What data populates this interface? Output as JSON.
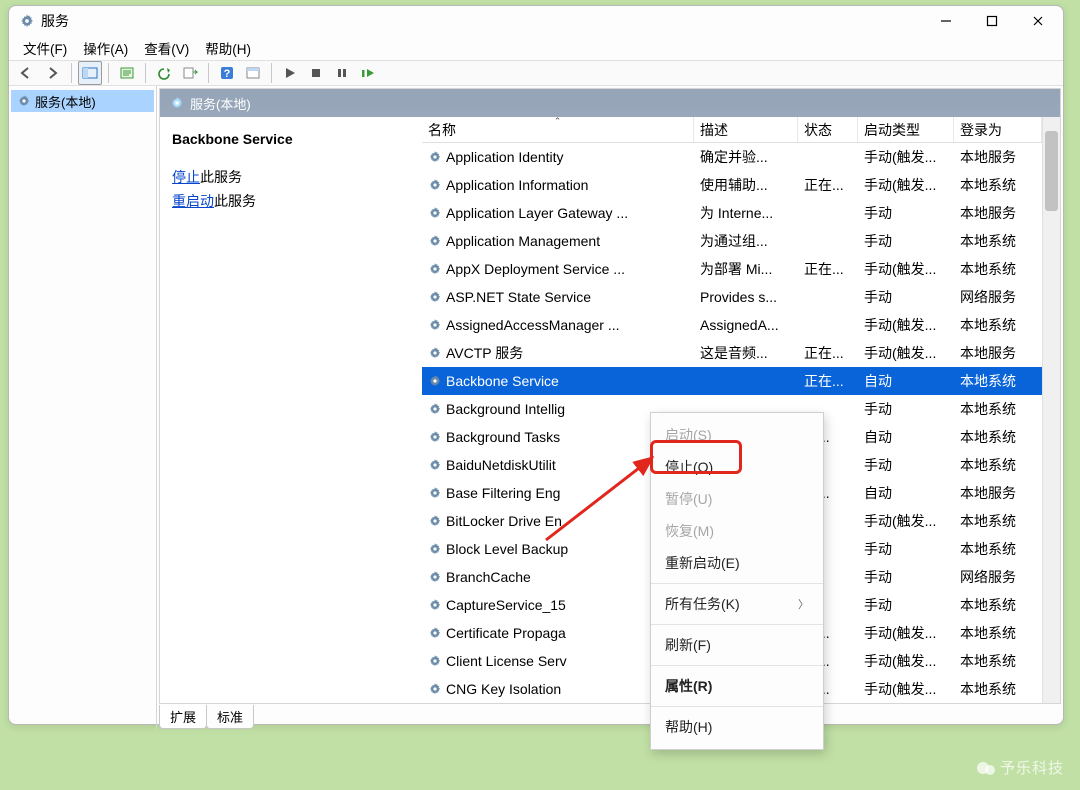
{
  "window": {
    "title": "服务"
  },
  "menu": {
    "file": "文件(F)",
    "action": "操作(A)",
    "view": "查看(V)",
    "help": "帮助(H)"
  },
  "tree": {
    "root": "服务(本地)"
  },
  "main_header": "服务(本地)",
  "detail": {
    "title": "Backbone Service",
    "stop_link": "停止",
    "stop_suffix": "此服务",
    "restart_link": "重启动",
    "restart_suffix": "此服务"
  },
  "columns": {
    "name": "名称",
    "desc": "描述",
    "status": "状态",
    "start": "启动类型",
    "login": "登录为"
  },
  "rows": [
    {
      "name": "Application Identity",
      "desc": "确定并验...",
      "status": "",
      "start": "手动(触发...",
      "login": "本地服务"
    },
    {
      "name": "Application Information",
      "desc": "使用辅助...",
      "status": "正在...",
      "start": "手动(触发...",
      "login": "本地系统"
    },
    {
      "name": "Application Layer Gateway ...",
      "desc": "为 Interne...",
      "status": "",
      "start": "手动",
      "login": "本地服务"
    },
    {
      "name": "Application Management",
      "desc": "为通过组...",
      "status": "",
      "start": "手动",
      "login": "本地系统"
    },
    {
      "name": "AppX Deployment Service ...",
      "desc": "为部署 Mi...",
      "status": "正在...",
      "start": "手动(触发...",
      "login": "本地系统"
    },
    {
      "name": "ASP.NET State Service",
      "desc": "Provides s...",
      "status": "",
      "start": "手动",
      "login": "网络服务"
    },
    {
      "name": "AssignedAccessManager ...",
      "desc": "AssignedA...",
      "status": "",
      "start": "手动(触发...",
      "login": "本地系统"
    },
    {
      "name": "AVCTP 服务",
      "desc": "这是音频...",
      "status": "正在...",
      "start": "手动(触发...",
      "login": "本地服务"
    },
    {
      "name": "Backbone Service",
      "desc": "",
      "status": "正在...",
      "start": "自动",
      "login": "本地系统",
      "selected": true
    },
    {
      "name": "Background Intellig",
      "desc": "",
      "status": "",
      "start": "手动",
      "login": "本地系统"
    },
    {
      "name": "Background Tasks",
      "desc": "",
      "status": "在...",
      "start": "自动",
      "login": "本地系统"
    },
    {
      "name": "BaiduNetdiskUtilit",
      "desc": "",
      "status": "",
      "start": "手动",
      "login": "本地系统"
    },
    {
      "name": "Base Filtering Eng",
      "desc": "",
      "status": "在...",
      "start": "自动",
      "login": "本地服务"
    },
    {
      "name": "BitLocker Drive En",
      "desc": "",
      "status": "",
      "start": "手动(触发...",
      "login": "本地系统"
    },
    {
      "name": "Block Level Backup",
      "desc": "",
      "status": "",
      "start": "手动",
      "login": "本地系统"
    },
    {
      "name": "BranchCache",
      "desc": "",
      "status": "",
      "start": "手动",
      "login": "网络服务"
    },
    {
      "name": "CaptureService_15",
      "desc": "",
      "status": "",
      "start": "手动",
      "login": "本地系统"
    },
    {
      "name": "Certificate Propaga",
      "desc": "",
      "status": "在...",
      "start": "手动(触发...",
      "login": "本地系统"
    },
    {
      "name": "Client License Serv",
      "desc": "",
      "status": "在...",
      "start": "手动(触发...",
      "login": "本地系统"
    },
    {
      "name": "CNG Key Isolation",
      "desc": "",
      "status": "在...",
      "start": "手动(触发...",
      "login": "本地系统"
    }
  ],
  "tabs": {
    "ext": "扩展",
    "std": "标准"
  },
  "ctx": {
    "start": "启动(S)",
    "stop": "停止(O)",
    "pause": "暂停(U)",
    "resume": "恢复(M)",
    "restart": "重新启动(E)",
    "all_tasks": "所有任务(K)",
    "refresh": "刷新(F)",
    "properties": "属性(R)",
    "help": "帮助(H)"
  },
  "watermark": "予乐科技"
}
